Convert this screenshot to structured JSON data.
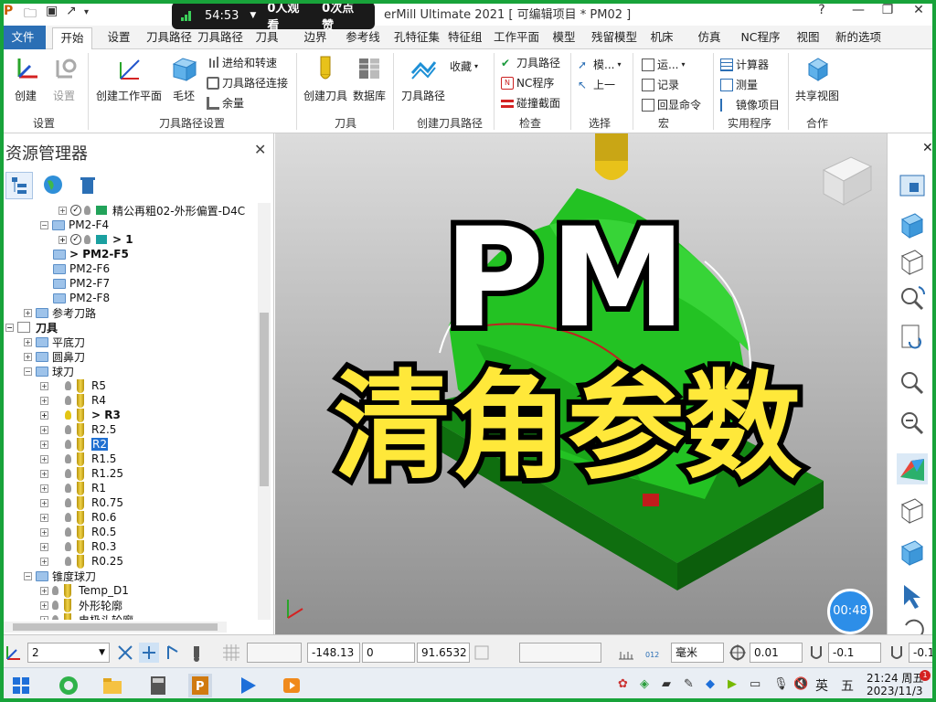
{
  "title_bar": {
    "app_title": "erMill Ultimate 2021 [ 可编辑项目 * PM02 ]",
    "window_controls": [
      "?",
      "—",
      "❐",
      "✕"
    ]
  },
  "live_overlay": {
    "time": "54:53",
    "viewers": "0人观看",
    "likes": "0次点赞"
  },
  "ribbon_tabs": [
    "文件",
    "开始",
    "设置",
    "刀具路径",
    "刀具路径",
    "刀具",
    "边界",
    "参考线",
    "孔特征集",
    "特征组",
    "工作平面",
    "模型",
    "残留模型",
    "机床",
    "仿真",
    "NC程序",
    "视图",
    "新的选项"
  ],
  "active_tab": "开始",
  "ribbon": {
    "create": "创建",
    "settings": "设置",
    "create_workplane": "创建工作平面",
    "block": "毛坯",
    "feed_speed": "进给和转速",
    "toolpath_connect": "刀具路径连接",
    "allowance": "余量",
    "create_tool": "创建刀具",
    "database": "数据库",
    "toolpath": "刀具路径",
    "favorites": "收藏",
    "check_toolpath": "刀具路径",
    "check_nc": "NC程序",
    "collision_section": "碰撞截面",
    "select_model": "模...",
    "select_up": "上一",
    "macro_run": "运...",
    "macro_record": "记录",
    "macro_echo": "回显命令",
    "calculator": "计算器",
    "measure": "测量",
    "mirror": "镜像项目",
    "shared_view": "共享视图",
    "groups": {
      "setup": "设置",
      "toolpath_setup": "刀具路径设置",
      "tools": "刀具",
      "create_toolpath": "创建刀具路径",
      "check": "检查",
      "select": "选择",
      "macro": "宏",
      "utilities": "实用程序",
      "collab": "合作"
    }
  },
  "explorer": {
    "title": "资源管理器",
    "tree": [
      {
        "label": "精公再粗02-外形偏置-D4C",
        "indent": 3
      },
      {
        "label": "PM2-F4",
        "indent": 2
      },
      {
        "label": "> 1",
        "indent": 3
      },
      {
        "label": "> PM2-F5",
        "indent": 2
      },
      {
        "label": "PM2-F6",
        "indent": 2
      },
      {
        "label": "PM2-F7",
        "indent": 2
      },
      {
        "label": "PM2-F8",
        "indent": 2
      },
      {
        "label": "参考刀路",
        "indent": 1
      },
      {
        "label": "刀具",
        "indent": 0
      },
      {
        "label": "平底刀",
        "indent": 1
      },
      {
        "label": "圆鼻刀",
        "indent": 1
      },
      {
        "label": "球刀",
        "indent": 1
      },
      {
        "label": "R5",
        "indent": 2
      },
      {
        "label": "R4",
        "indent": 2
      },
      {
        "label": "> R3",
        "indent": 2
      },
      {
        "label": "R2.5",
        "indent": 2
      },
      {
        "label": "R2",
        "indent": 2
      },
      {
        "label": "R1.5",
        "indent": 2
      },
      {
        "label": "R1.25",
        "indent": 2
      },
      {
        "label": "R1",
        "indent": 2
      },
      {
        "label": "R0.75",
        "indent": 2
      },
      {
        "label": "R0.6",
        "indent": 2
      },
      {
        "label": "R0.5",
        "indent": 2
      },
      {
        "label": "R0.3",
        "indent": 2
      },
      {
        "label": "R0.25",
        "indent": 2
      },
      {
        "label": "锥度球刀",
        "indent": 1
      },
      {
        "label": "Temp_D1",
        "indent": 2
      },
      {
        "label": "外形轮廓",
        "indent": 2
      },
      {
        "label": "电极头轮廓",
        "indent": 2
      }
    ]
  },
  "overlay_text": {
    "line1": "PM",
    "line2": "清角参数"
  },
  "timer": "00:48",
  "status_bar": {
    "level": "2",
    "x": "-148.13",
    "y": "0",
    "z": "91.6532",
    "units": "毫米",
    "tolerance": "0.01",
    "thickness": "-0.1",
    "thickness2": "-0.1"
  },
  "taskbar": {
    "ime": "英",
    "ime_mode": "五",
    "time": "21:24 周五",
    "date": "2023/11/3"
  },
  "colors": {
    "accent": "#2b6fb5",
    "model_green": "#1fb81f",
    "overlay_yellow": "#ffe83a",
    "frame_green": "#18a33a"
  }
}
